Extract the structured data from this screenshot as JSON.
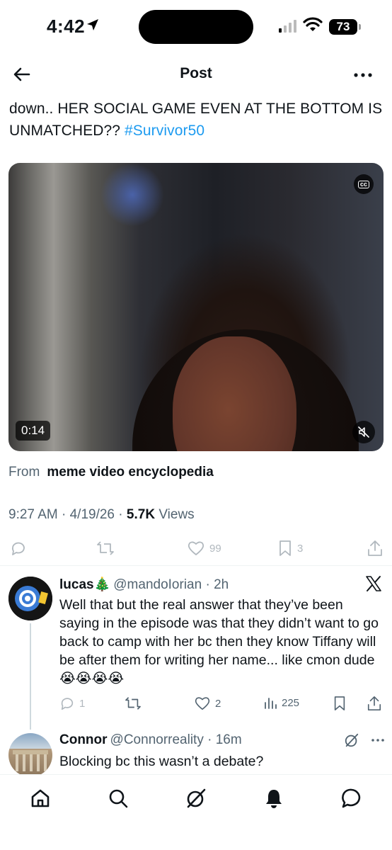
{
  "status_bar": {
    "time": "4:42",
    "battery": "73"
  },
  "header": {
    "title": "Post"
  },
  "tweet": {
    "text_prefix": "down.. HER SOCIAL GAME EVEN AT THE BOTTOM IS UNMATCHED?? ",
    "hashtag": "#Survivor50",
    "video_duration": "0:14",
    "from_label": "From",
    "from_source": "meme video encyclopedia",
    "time": "9:27 AM",
    "date": "4/19/26",
    "views_count": "5.7K",
    "views_label": "Views",
    "likes": "99",
    "bookmarks": "3"
  },
  "replies": [
    {
      "name": "lucas",
      "emoji": "🎄",
      "handle": "@mandoIorian",
      "time": "2h",
      "text": "Well that but the real answer that they’ve been saying in the episode was that they didn’t want to go back to camp with her bc then they know Tiffany will be after them for writing her name... like cmon dude 😭😭😭😭",
      "replies_count": "1",
      "likes": "2",
      "views": "225"
    },
    {
      "name": "Connor",
      "handle": "@Connorreality",
      "time": "16m",
      "text": "Blocking bc this wasn’t a debate?"
    }
  ],
  "colors": {
    "accent": "#1d9bf0",
    "secondary_text": "#536471",
    "text": "#0f1419"
  },
  "icons": {
    "header": [
      "back-arrow-icon",
      "more-icon"
    ],
    "actions": [
      "reply-icon",
      "repost-icon",
      "like-icon",
      "bookmark-icon",
      "share-icon"
    ],
    "reply_actions": [
      "reply-icon",
      "repost-icon",
      "like-icon",
      "views-icon",
      "bookmark-icon",
      "share-icon"
    ],
    "nav": [
      "home-icon",
      "search-icon",
      "grok-icon",
      "notifications-icon",
      "messages-icon"
    ]
  }
}
